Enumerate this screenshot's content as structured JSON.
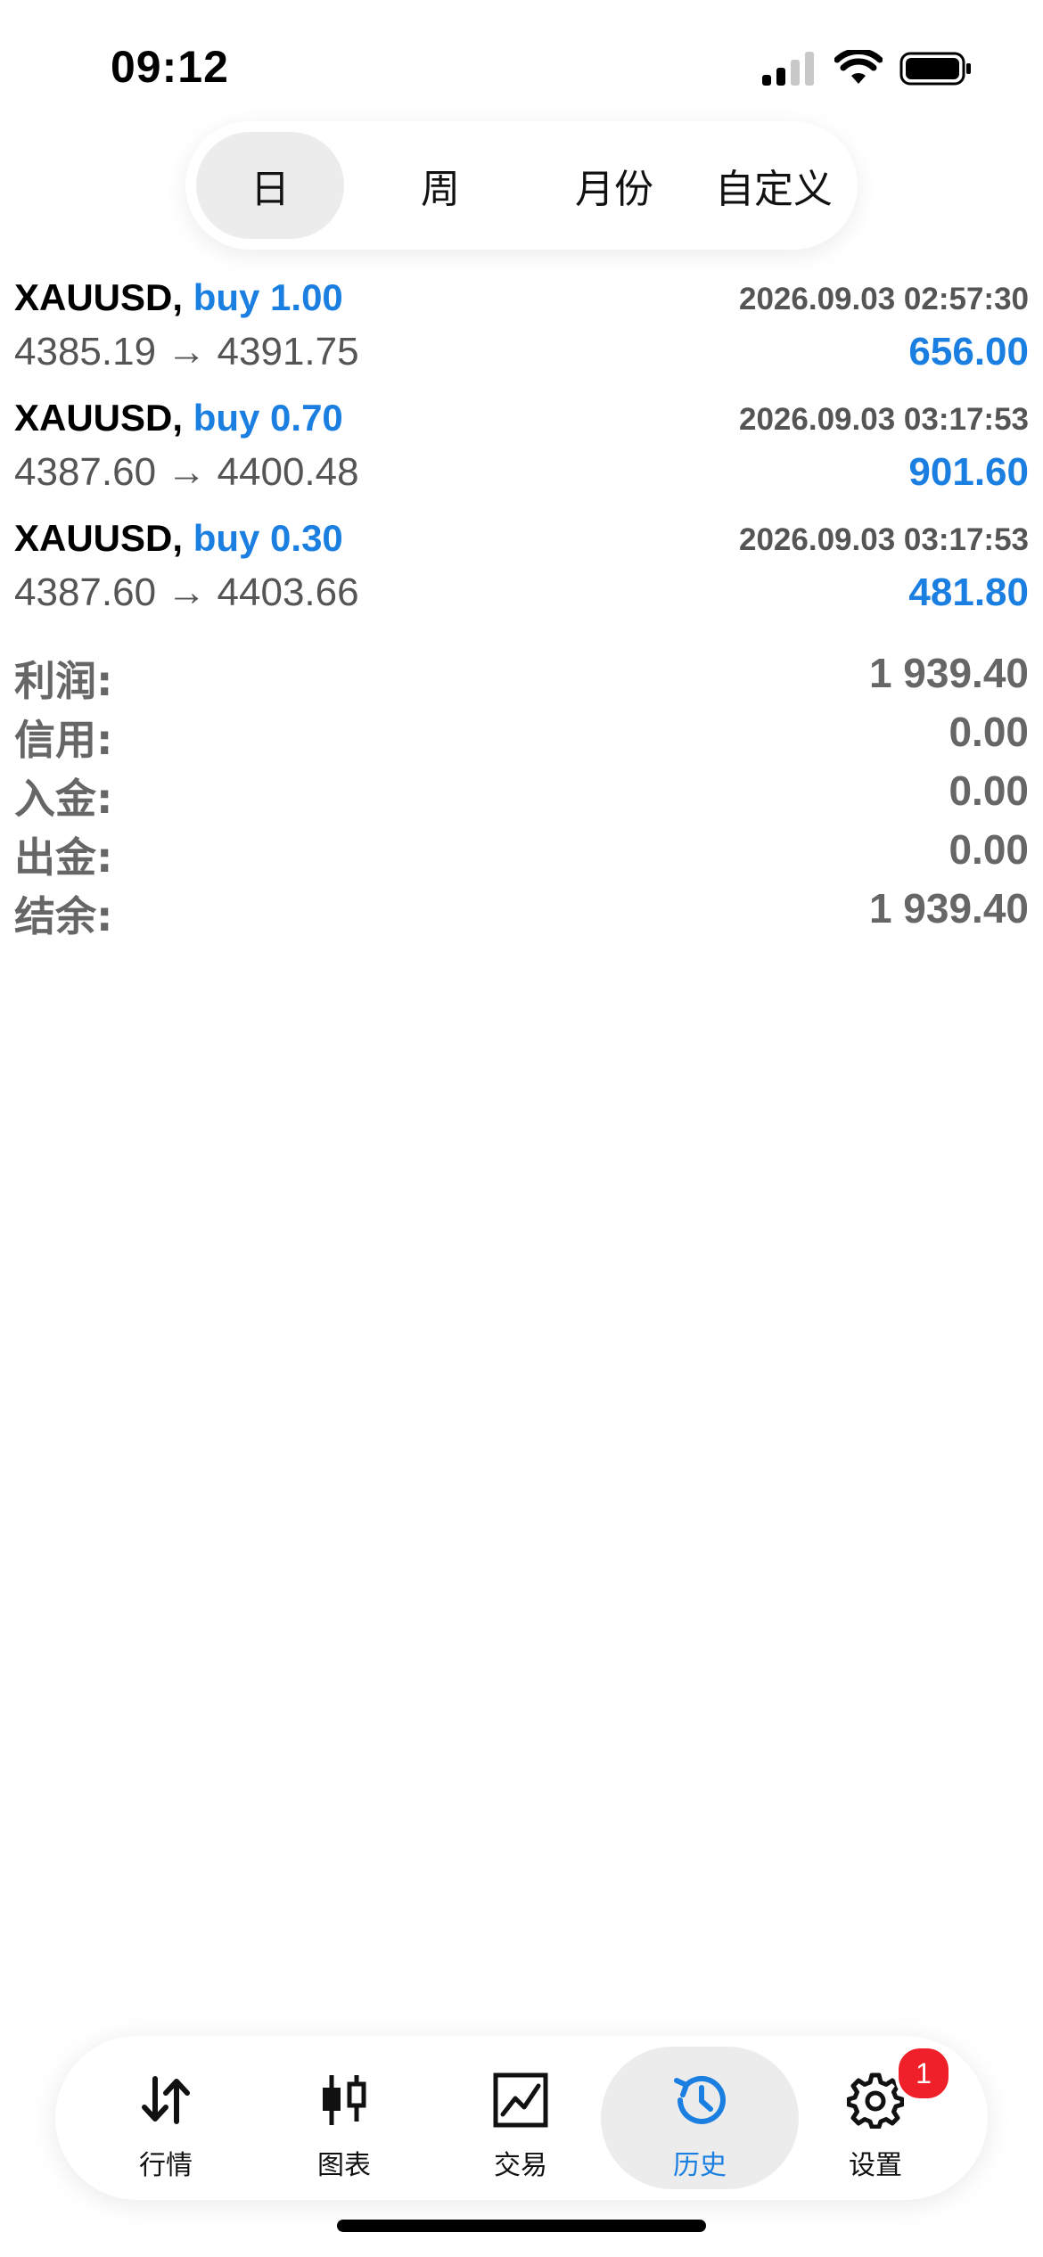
{
  "status_bar": {
    "time": "09:12"
  },
  "period_tabs": [
    {
      "label": "日",
      "active": true
    },
    {
      "label": "周",
      "active": false
    },
    {
      "label": "月份",
      "active": false
    },
    {
      "label": "自定义",
      "active": false
    }
  ],
  "deals": [
    {
      "symbol": "XAUUSD,",
      "type": "buy",
      "volume": "1.00",
      "time": "2026.09.03 02:57:30",
      "price_open": "4385.19",
      "price_close": "4391.75",
      "profit": "656.00"
    },
    {
      "symbol": "XAUUSD,",
      "type": "buy",
      "volume": "0.70",
      "time": "2026.09.03 03:17:53",
      "price_open": "4387.60",
      "price_close": "4400.48",
      "profit": "901.60"
    },
    {
      "symbol": "XAUUSD,",
      "type": "buy",
      "volume": "0.30",
      "time": "2026.09.03 03:17:53",
      "price_open": "4387.60",
      "price_close": "4403.66",
      "profit": "481.80"
    }
  ],
  "arrow": "→",
  "summary": [
    {
      "label": "利润:",
      "value": "1 939.40"
    },
    {
      "label": "信用:",
      "value": "0.00"
    },
    {
      "label": "入金:",
      "value": "0.00"
    },
    {
      "label": "出金:",
      "value": "0.00"
    },
    {
      "label": "结余:",
      "value": "1 939.40"
    }
  ],
  "bottom_nav": [
    {
      "label": "行情",
      "icon": "quotes-arrows-icon",
      "active": false
    },
    {
      "label": "图表",
      "icon": "candlestick-chart-icon",
      "active": false
    },
    {
      "label": "交易",
      "icon": "trade-chart-icon",
      "active": false
    },
    {
      "label": "历史",
      "icon": "history-clock-icon",
      "active": true
    },
    {
      "label": "设置",
      "icon": "gear-icon",
      "active": false,
      "badge": "1"
    }
  ],
  "colors": {
    "accent": "#1a7fe0",
    "badge": "#f0202a",
    "muted_text": "#555555"
  }
}
